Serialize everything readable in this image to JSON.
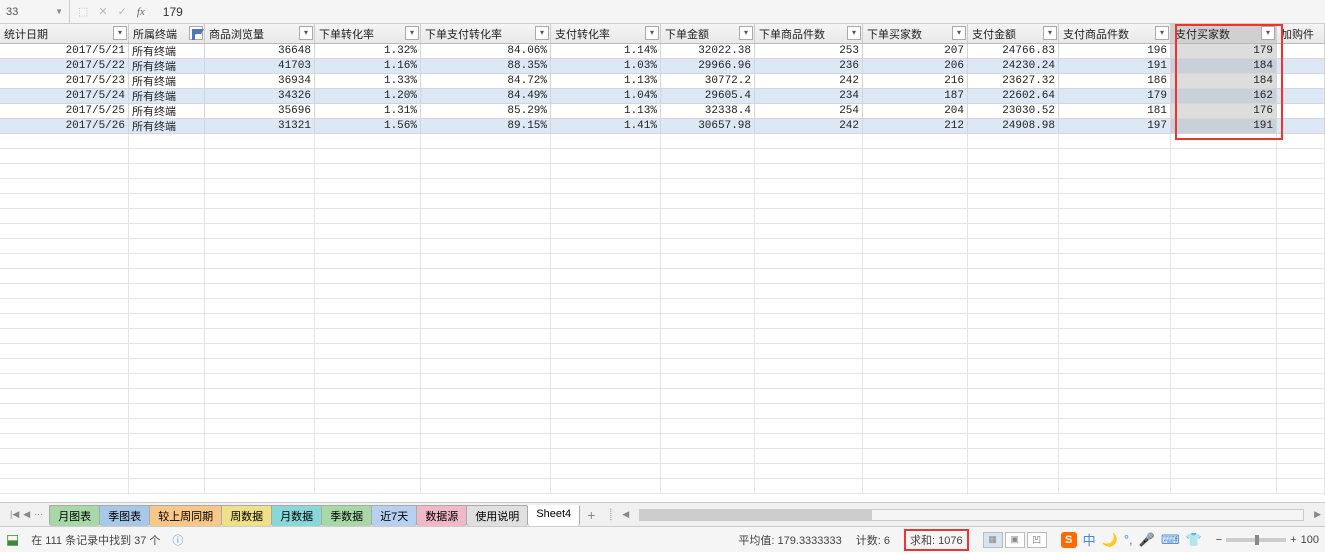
{
  "formula_bar": {
    "name_box": "33",
    "fx_label": "fx",
    "value": "179"
  },
  "columns": [
    {
      "label": "统计日期",
      "filtered": false
    },
    {
      "label": "所属终端",
      "filtered": true
    },
    {
      "label": "商品浏览量",
      "filtered": false
    },
    {
      "label": "下单转化率",
      "filtered": false
    },
    {
      "label": "下单支付转化率",
      "filtered": false
    },
    {
      "label": "支付转化率",
      "filtered": false
    },
    {
      "label": "下单金额",
      "filtered": false
    },
    {
      "label": "下单商品件数",
      "filtered": false
    },
    {
      "label": "下单买家数",
      "filtered": false
    },
    {
      "label": "支付金额",
      "filtered": false
    },
    {
      "label": "支付商品件数",
      "filtered": false
    },
    {
      "label": "支付买家数",
      "filtered": false
    },
    {
      "label": "加购件",
      "filtered": false
    }
  ],
  "rows": [
    {
      "date": "2017/5/21",
      "term": "所有终端",
      "views": "36648",
      "r1": "1.32%",
      "r2": "84.06%",
      "r3": "1.14%",
      "amt": "32022.38",
      "qty": "253",
      "buyers": "207",
      "payamt": "24766.83",
      "payqty": "196",
      "paybuyers": "179"
    },
    {
      "date": "2017/5/22",
      "term": "所有终端",
      "views": "41703",
      "r1": "1.16%",
      "r2": "88.35%",
      "r3": "1.03%",
      "amt": "29966.96",
      "qty": "236",
      "buyers": "206",
      "payamt": "24230.24",
      "payqty": "191",
      "paybuyers": "184"
    },
    {
      "date": "2017/5/23",
      "term": "所有终端",
      "views": "36934",
      "r1": "1.33%",
      "r2": "84.72%",
      "r3": "1.13%",
      "amt": "30772.2",
      "qty": "242",
      "buyers": "216",
      "payamt": "23627.32",
      "payqty": "186",
      "paybuyers": "184"
    },
    {
      "date": "2017/5/24",
      "term": "所有终端",
      "views": "34326",
      "r1": "1.20%",
      "r2": "84.49%",
      "r3": "1.04%",
      "amt": "29605.4",
      "qty": "234",
      "buyers": "187",
      "payamt": "22602.64",
      "payqty": "179",
      "paybuyers": "162"
    },
    {
      "date": "2017/5/25",
      "term": "所有终端",
      "views": "35696",
      "r1": "1.31%",
      "r2": "85.29%",
      "r3": "1.13%",
      "amt": "32338.4",
      "qty": "254",
      "buyers": "204",
      "payamt": "23030.52",
      "payqty": "181",
      "paybuyers": "176"
    },
    {
      "date": "2017/5/26",
      "term": "所有终端",
      "views": "31321",
      "r1": "1.56%",
      "r2": "89.15%",
      "r3": "1.41%",
      "amt": "30657.98",
      "qty": "242",
      "buyers": "212",
      "payamt": "24908.98",
      "payqty": "197",
      "paybuyers": "191"
    }
  ],
  "sheet_tabs": [
    {
      "label": "月图表",
      "color": "c-green"
    },
    {
      "label": "季图表",
      "color": "c-blue"
    },
    {
      "label": "较上周同期",
      "color": "c-orange"
    },
    {
      "label": "周数据",
      "color": "c-yellow"
    },
    {
      "label": "月数据",
      "color": "c-teal"
    },
    {
      "label": "季数据",
      "color": "c-green"
    },
    {
      "label": "近7天",
      "color": "c-lblue"
    },
    {
      "label": "数据源",
      "color": "c-pink"
    },
    {
      "label": "使用说明",
      "color": ""
    },
    {
      "label": "Sheet4",
      "color": "active"
    }
  ],
  "status_bar": {
    "ready_text": "在 111 条记录中找到 37 个",
    "avg_label": "平均值: 179.3333333",
    "count_label": "计数: 6",
    "sum_label": "求和: 1076",
    "ime_s": "S",
    "ime_zhong": "中",
    "zoom_value": "100"
  }
}
